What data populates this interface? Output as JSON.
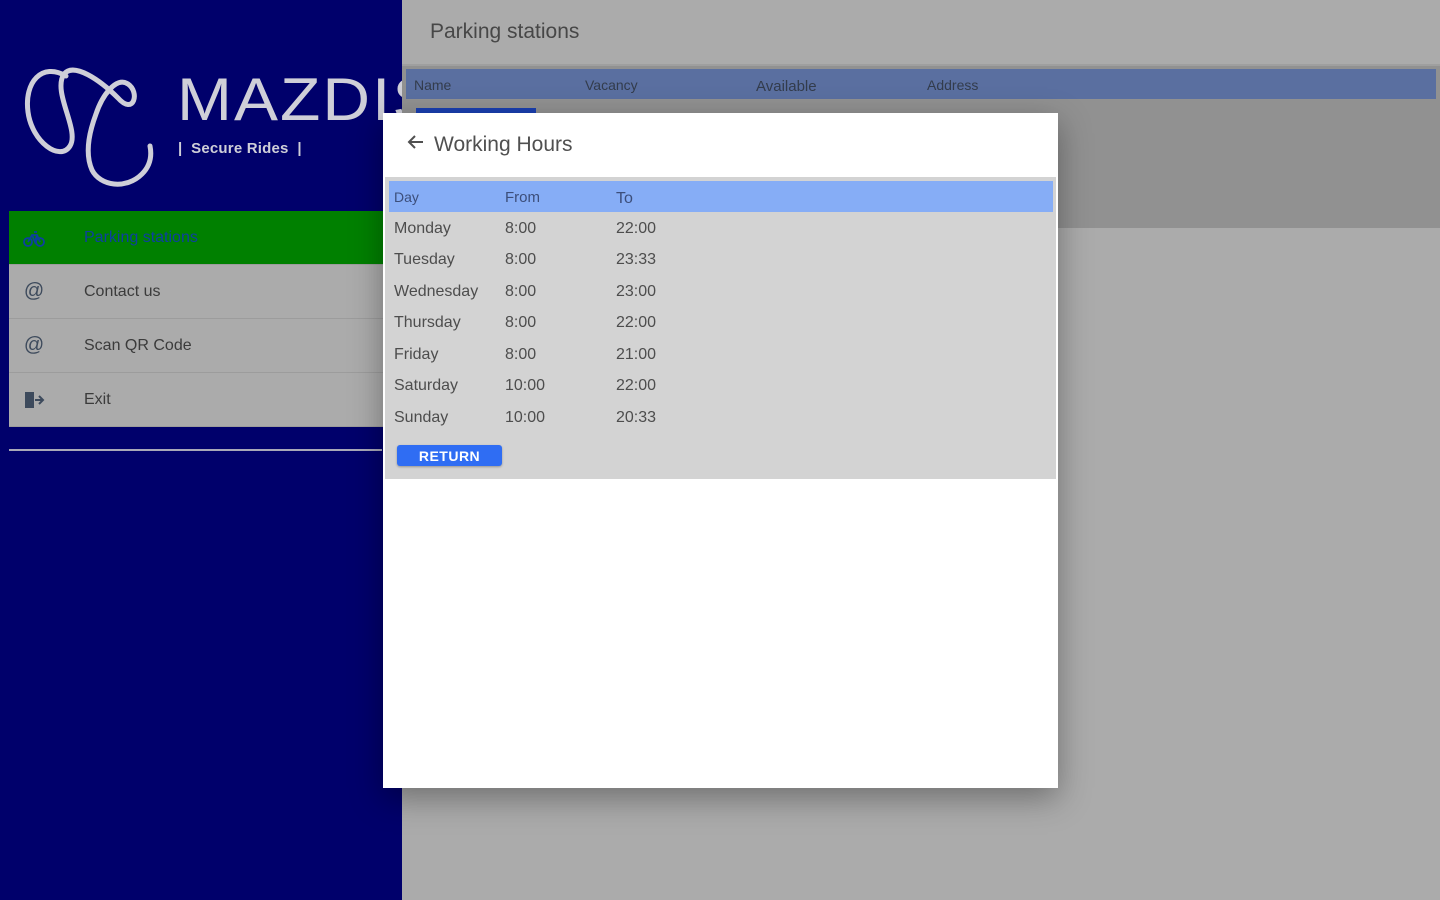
{
  "brand": {
    "name": "MAZDIS",
    "tagline": "|  Secure Rides  |"
  },
  "sidebar": {
    "items": [
      {
        "label": "Parking stations",
        "icon": "bicycle-icon",
        "active": true
      },
      {
        "label": "Contact us",
        "icon": "at-sign-icon",
        "active": false
      },
      {
        "label": "Scan QR Code",
        "icon": "at-sign-icon",
        "active": false
      },
      {
        "label": "Exit",
        "icon": "exit-door-icon",
        "active": false
      }
    ]
  },
  "main": {
    "title": "Parking stations",
    "table_headers": [
      "Name",
      "Vacancy",
      "Available",
      "Address"
    ]
  },
  "modal": {
    "title": "Working Hours",
    "columns": [
      "Day",
      "From",
      "To"
    ],
    "rows": [
      {
        "day": "Monday",
        "from": "8:00",
        "to": "22:00"
      },
      {
        "day": "Tuesday",
        "from": "8:00",
        "to": "23:33"
      },
      {
        "day": "Wednesday",
        "from": "8:00",
        "to": "23:00"
      },
      {
        "day": "Thursday",
        "from": "8:00",
        "to": "22:00"
      },
      {
        "day": "Friday",
        "from": "8:00",
        "to": "21:00"
      },
      {
        "day": "Saturday",
        "from": "10:00",
        "to": "22:00"
      },
      {
        "day": "Sunday",
        "from": "10:00",
        "to": "20:33"
      }
    ],
    "return_label": "RETURN"
  },
  "colors": {
    "sidebar_bg": "#00006b",
    "active_item": "#008000",
    "table_header": "#86adf6",
    "button": "#2f6df3"
  }
}
